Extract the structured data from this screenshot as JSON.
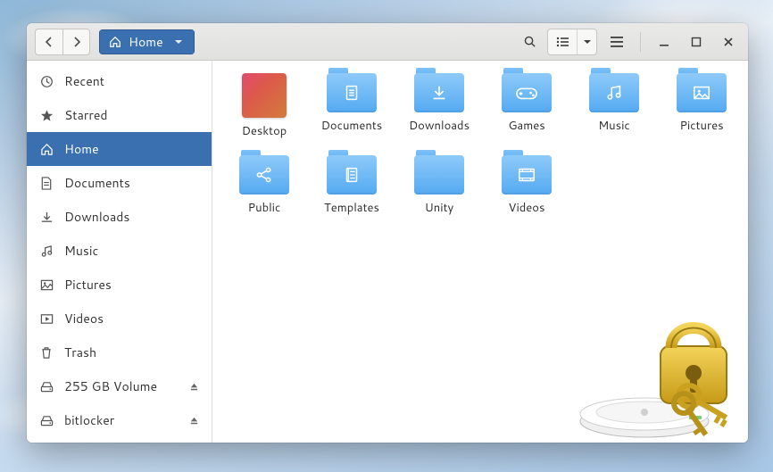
{
  "path": {
    "current": "Home"
  },
  "sidebar": {
    "items": [
      {
        "icon": "clock-icon",
        "label": "Recent"
      },
      {
        "icon": "star-icon",
        "label": "Starred"
      },
      {
        "icon": "home-icon",
        "label": "Home",
        "selected": true
      },
      {
        "icon": "document-icon",
        "label": "Documents"
      },
      {
        "icon": "download-icon",
        "label": "Downloads"
      },
      {
        "icon": "music-icon",
        "label": "Music"
      },
      {
        "icon": "pictures-icon",
        "label": "Pictures"
      },
      {
        "icon": "videos-icon",
        "label": "Videos"
      },
      {
        "icon": "trash-icon",
        "label": "Trash"
      },
      {
        "icon": "drive-icon",
        "label": "255 GB Volume",
        "ejectable": true
      },
      {
        "icon": "drive-icon",
        "label": "bitlocker",
        "ejectable": true
      }
    ]
  },
  "files": [
    {
      "label": "Desktop",
      "type": "desktop"
    },
    {
      "label": "Documents",
      "type": "folder",
      "glyph": "doc"
    },
    {
      "label": "Downloads",
      "type": "folder",
      "glyph": "down"
    },
    {
      "label": "Games",
      "type": "folder",
      "glyph": "game"
    },
    {
      "label": "Music",
      "type": "folder",
      "glyph": "music"
    },
    {
      "label": "Pictures",
      "type": "folder",
      "glyph": "pic"
    },
    {
      "label": "Public",
      "type": "folder",
      "glyph": "share"
    },
    {
      "label": "Templates",
      "type": "folder",
      "glyph": "tmpl"
    },
    {
      "label": "Unity",
      "type": "folder",
      "glyph": "plain"
    },
    {
      "label": "Videos",
      "type": "folder",
      "glyph": "video"
    }
  ]
}
